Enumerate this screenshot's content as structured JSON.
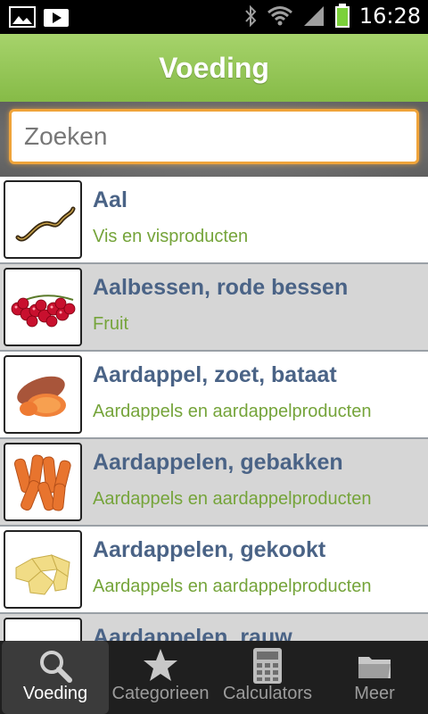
{
  "status_bar": {
    "time": "16:28",
    "icons": [
      "image-icon",
      "play-store-icon",
      "bluetooth-icon",
      "wifi-icon",
      "signal-icon",
      "battery-icon"
    ]
  },
  "header": {
    "title": "Voeding",
    "color": "#8dc14f"
  },
  "search": {
    "placeholder": "Zoeken",
    "value": ""
  },
  "list": {
    "items": [
      {
        "title": "Aal",
        "subtitle": "Vis en visproducten",
        "icon": "eel-icon"
      },
      {
        "title": "Aalbessen, rode bessen",
        "subtitle": "Fruit",
        "icon": "red-currants-icon"
      },
      {
        "title": "Aardappel, zoet, bataat",
        "subtitle": "Aardappels en aardappelproducten",
        "icon": "sweet-potato-icon"
      },
      {
        "title": "Aardappelen, gebakken",
        "subtitle": "Aardappels en aardappelproducten",
        "icon": "fried-potatoes-icon"
      },
      {
        "title": "Aardappelen, gekookt",
        "subtitle": "Aardappels en aardappelproducten",
        "icon": "boiled-potatoes-icon"
      },
      {
        "title": "Aardappelen, rauw",
        "subtitle": "",
        "icon": "potato-icon"
      }
    ]
  },
  "bottom_nav": {
    "tabs": [
      {
        "label": "Voeding",
        "icon": "search-icon",
        "active": true
      },
      {
        "label": "Categorieen",
        "icon": "star-icon",
        "active": false
      },
      {
        "label": "Calculators",
        "icon": "calculator-icon",
        "active": false
      },
      {
        "label": "Meer",
        "icon": "folder-icon",
        "active": false
      }
    ]
  },
  "colors": {
    "accent_orange": "#f0a43a",
    "title_blue": "#4a6386",
    "subtitle_green": "#75a43a"
  }
}
